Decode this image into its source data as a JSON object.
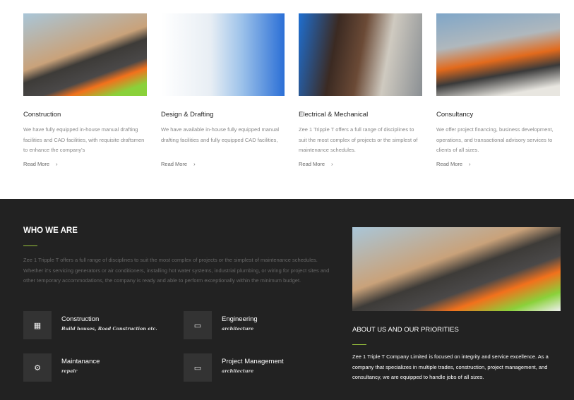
{
  "services": [
    {
      "title": "Construction",
      "desc": "We have fully equipped in-house manual drafting facilities and CAD facilities, with requisite draftsmen to enhance the company's",
      "link": "Read More",
      "img": "construction-worker-photo"
    },
    {
      "title": "Design & Drafting",
      "desc": "We have available in-house fully equipped manual drafting facilities and fully equipped CAD facilities,",
      "link": "Read More",
      "img": "house-drafting-render"
    },
    {
      "title": "Electrical & Mechanical",
      "desc": "Zee 1 Tripple T offers a full range of disciplines to suit the most complex of projects or the simplest of maintenance schedules.",
      "link": "Read More",
      "img": "electrician-photo"
    },
    {
      "title": "Consultancy",
      "desc": "We offer project financing, business development, operations, and transactional advisory services to clients of all sizes.",
      "link": "Read More",
      "img": "engineers-with-plans-photo"
    }
  ],
  "who": {
    "title": "WHO WE ARE",
    "text": "Zee 1 Tripple T offers a full range of disciplines to suit the most complex of projects or the simplest of maintenance schedules. Whether it's servicing generators or air conditioners, installing hot water systems, industrial plumbing, or wiring for project sites and other temporary accommodations, the company is ready and able to perform exceptionally within the minimum budget."
  },
  "features": [
    {
      "title": "Construction",
      "sub": "Build houses, Road Construction etc.",
      "icon": "building-icon"
    },
    {
      "title": "Engineering",
      "sub": "architecture",
      "icon": "monitor-icon"
    },
    {
      "title": "Maintanance",
      "sub": "repair",
      "icon": "gears-icon"
    },
    {
      "title": "Project Management",
      "sub": "architecture",
      "icon": "monitor-icon"
    }
  ],
  "about": {
    "title": "ABOUT US AND OUR PRIORITIES",
    "text": "Zee 1 Triple T Company Limited is focused on integrity and service excellence. As a company that specializes in multiple trades, construction, project management, and consultancy, we are equipped to handle jobs of all sizes."
  },
  "colors": {
    "accent": "#9bc53d",
    "dark_bg": "#222222"
  }
}
